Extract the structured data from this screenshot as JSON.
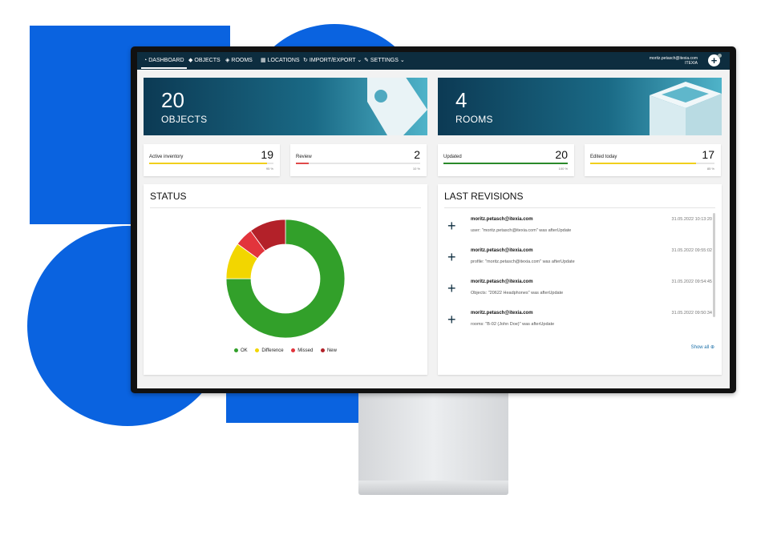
{
  "nav": {
    "items": [
      {
        "label": "Dashboard",
        "icon": "dashboard-icon",
        "active": true
      },
      {
        "label": "Objects",
        "icon": "tag-icon"
      },
      {
        "label": "Rooms",
        "icon": "cube-icon"
      },
      {
        "label": "Locations",
        "icon": "building-icon"
      },
      {
        "label": "Import/Export",
        "icon": "sync-icon",
        "dropdown": true
      },
      {
        "label": "Settings",
        "icon": "wrench-icon",
        "dropdown": true
      }
    ],
    "user_email": "moritz.petasch@itexia.com",
    "user_org": "ITEXIA"
  },
  "hero": {
    "objects": {
      "count": "20",
      "label": "OBJECTS",
      "icon": "tag-icon"
    },
    "rooms": {
      "count": "4",
      "label": "ROOMS",
      "icon": "cube-icon"
    }
  },
  "stats": [
    {
      "title": "Active inventory",
      "value": "19",
      "percent_label": "95 %",
      "percent": 95,
      "color": "#f0cf1c"
    },
    {
      "title": "Review",
      "value": "2",
      "percent_label": "10 %",
      "percent": 10,
      "color": "#e04a4a"
    },
    {
      "title": "Updated",
      "value": "20",
      "percent_label": "100 %",
      "percent": 100,
      "color": "#2a8a2a"
    },
    {
      "title": "Edited today",
      "value": "17",
      "percent_label": "85 %",
      "percent": 85,
      "color": "#f0cf1c"
    }
  ],
  "status": {
    "title": "STATUS",
    "chart_data": {
      "type": "pie",
      "donut": true,
      "categories": [
        "OK",
        "Difference",
        "Missed",
        "New"
      ],
      "values": [
        15,
        2,
        1,
        2
      ],
      "colors": [
        "#32a02a",
        "#f2d600",
        "#e2343c",
        "#b32129"
      ]
    }
  },
  "revisions": {
    "title": "LAST REVISIONS",
    "items": [
      {
        "user": "moritz.petasch@itexia.com",
        "text": "user: \"moritz.petasch@itexia.com\" was afterUpdate",
        "time": "31.05.2022 10:13:20"
      },
      {
        "user": "moritz.petasch@itexia.com",
        "text": "profile: \"moritz.petasch@itexia.com\" was afterUpdate",
        "time": "31.05.2022 09:55:02"
      },
      {
        "user": "moritz.petasch@itexia.com",
        "text": "Objects: \"20622 Headphones\" was afterUpdate",
        "time": "31.05.2022 09:54:45"
      },
      {
        "user": "moritz.petasch@itexia.com",
        "text": "rooms: \"B-02 (John Doe)\" was afterUpdate",
        "time": "31.05.2022 09:50:34"
      }
    ],
    "show_all": "Show all"
  }
}
